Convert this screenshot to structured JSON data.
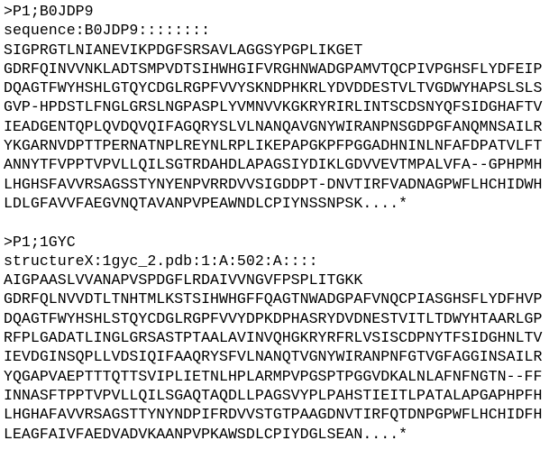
{
  "entries": [
    {
      "header": ">P1;B0JDP9",
      "description": "sequence:B0JDP9::::::::",
      "sequence": [
        "SIGPRGTLNIANEVIKPDGFSRSAVLAGGSYPGPLIKGET",
        "GDRFQINVVNKLADTSMPVDTSIHWHGIFVRGHNWADGPAMVTQCPIVPGHSFLYDFEIP",
        "DQAGTFWYHSHLGTQYCDGLRGPFVVYSKNDPHKRLYDVDDESTVLTVGDWYHAPSLSLS",
        "GVP-HPDSTLFNGLGRSLNGPASPLYVMNVVKGKRYRIRLINTSCDSNYQFSIDGHAFTV",
        "IEADGENTQPLQVDQVQIFAGQRYSLVLNANQAVGNYWIRANPNSGDPGFANQMNSAILR",
        "YKGARNVDPTTPERNATNPLREYNLRPLIKEPAPGKPFPGGADHNINLNFAFDPATVLFT",
        "ANNYTFVPPTVPVLLQILSGTRDAHDLAPAGSIYDIKLGDVVEVTMPALVFA--GPHPMH",
        "LHGHSFAVVRSAGSSTYNYENPVRRDVVSIGDDPT-DNVTIRFVADNAGPWFLHCHIDWH",
        "LDLGFAVVFAEGVNQTAVANPVPEAWNDLCPIYNSSNPSK....*"
      ]
    },
    {
      "header": ">P1;1GYC",
      "description": "structureX:1gyc_2.pdb:1:A:502:A::::",
      "sequence": [
        "AIGPAASLVVANAPVSPDGFLRDAIVVNGVFPSPLITGKK",
        "GDRFQLNVVDTLTNHTMLKSTSIHWHGFFQAGTNWADGPAFVNQCPIASGHSFLYDFHVP",
        "DQAGTFWYHSHLSTQYCDGLRGPFVVYDPKDPHASRYDVDNESTVITLTDWYHTAARLGP",
        "RFPLGADATLINGLGRSASTPTAALAVINVQHGKRYRFRLVSISCDPNYTFSIDGHNLTV",
        "IEVDGINSQPLLVDSIQIFAAQRYSFVLNANQTVGNYWIRANPNFGTVGFAGGINSAILR",
        "YQGAPVAEPTTTQTTSVIPLIETNLHPLARMPVPGSPTPGGVDKALNLAFNFNGTN--FF",
        "INNASFTPPTVPVLLQILSGAQTAQDLLPAGSVYPLPAHSTIEITLPATALAPGAPHPFH",
        "LHGHAFAVVRSAGSTTYNYNDPIFRDVVSTGTPAAGDNVTIRFQTDNPGPWFLHCHIDFH",
        "LEAGFAIVFAEDVADVKAANPVPKAWSDLCPIYDGLSEAN....*"
      ]
    }
  ]
}
